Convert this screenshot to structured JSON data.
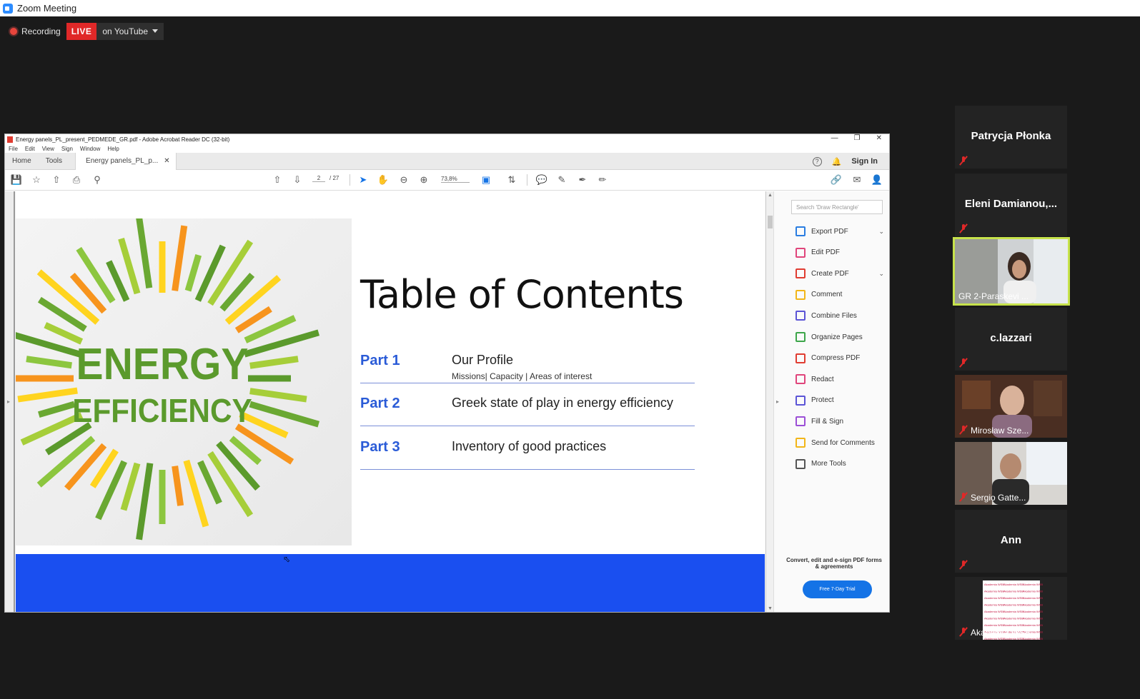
{
  "window": {
    "title": "Zoom Meeting"
  },
  "recording": {
    "label": "Recording",
    "live_badge": "LIVE",
    "stream_target": "on YouTube"
  },
  "acrobat": {
    "window_title": "Energy panels_PL_present_PEDMEDE_GR.pdf - Adobe Acrobat Reader DC (32-bit)",
    "menu": [
      "File",
      "Edit",
      "View",
      "Sign",
      "Window",
      "Help"
    ],
    "tabs": {
      "home": "Home",
      "tools": "Tools",
      "doc": "Energy panels_PL_p..."
    },
    "signin": "Sign In",
    "page_current": "2",
    "page_total": "/ 27",
    "zoom": "73,8%",
    "search_placeholder": "Search 'Draw Rectangle'",
    "tools": [
      {
        "label": "Export PDF",
        "color": "#2a7de1",
        "chevron": true
      },
      {
        "label": "Edit PDF",
        "color": "#e0457b"
      },
      {
        "label": "Create PDF",
        "color": "#e03c31",
        "chevron": true
      },
      {
        "label": "Comment",
        "color": "#f2b619"
      },
      {
        "label": "Combine Files",
        "color": "#5b54d6"
      },
      {
        "label": "Organize Pages",
        "color": "#3da64a"
      },
      {
        "label": "Compress PDF",
        "color": "#e03c31"
      },
      {
        "label": "Redact",
        "color": "#e0457b"
      },
      {
        "label": "Protect",
        "color": "#5b54d6"
      },
      {
        "label": "Fill & Sign",
        "color": "#9b4fd6"
      },
      {
        "label": "Send for Comments",
        "color": "#f2b619"
      },
      {
        "label": "More Tools",
        "color": "#555555"
      }
    ],
    "promo_text": "Convert, edit and e-sign PDF forms & agreements",
    "trial_button": "Free 7-Day Trial"
  },
  "slide": {
    "logo_line1": "ENERGY",
    "logo_line2": "EFFICIENCY",
    "title": "Table of Contents",
    "parts": [
      {
        "label": "Part 1",
        "title": "Our Profile",
        "subtitle": "Missions| Capacity | Areas of interest"
      },
      {
        "label": "Part 2",
        "title": "Greek state of play in energy efficiency"
      },
      {
        "label": "Part 3",
        "title": "Inventory of good practices"
      }
    ]
  },
  "participants": [
    {
      "name": "Patrycja Płonka",
      "video": false
    },
    {
      "name": "Eleni  Damianou,...",
      "video": false
    },
    {
      "name": "GR 2-Paraskevi ...",
      "video": true,
      "speaking": true
    },
    {
      "name": "c.lazzari",
      "video": false
    },
    {
      "name": "Mirosław Sze...",
      "video": true
    },
    {
      "name": "Sergio Gatte...",
      "video": true
    },
    {
      "name": "Ann",
      "video": false
    },
    {
      "name": "Akademia WSB",
      "video": true,
      "logo_text": "Akademia WSB"
    }
  ]
}
